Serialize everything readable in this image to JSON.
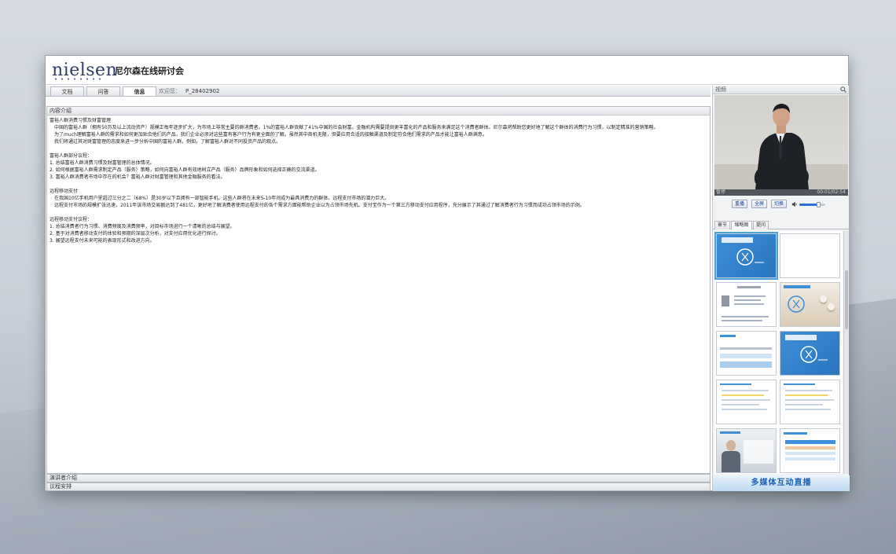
{
  "app": {
    "logo": "nielsen",
    "title": "尼尔森在线研讨会"
  },
  "tabs": [
    {
      "label": "文档"
    },
    {
      "label": "问答"
    },
    {
      "label": "信息"
    }
  ],
  "welcome": {
    "label": "欢迎您：",
    "user": "P_28402902"
  },
  "content": {
    "section_title": "内容介绍",
    "blocks": [
      {
        "text": "富裕人群消费习惯及财富管理",
        "indent": false
      },
      {
        "text": "中国的富裕人群（拥有50万及以上流动资产）规模正每年逐步扩大，为市场上非常主要的群消费者。1%的富裕人群贡献了41%中国的社会财富。金融机构需要提供更丰富化的产品和服务来满足这个消费者群体。尼尔森将帮助您更好地了解这个群体的消费行为习惯，以制定精准的营销策略。",
        "indent": true
      },
      {
        "text": "为了much理解富裕人群的需求和如何更加贴合他们的产品，我们企业必须对这些富有客户行为有更全面的了解。虽然其中商机无限，但要应用合适的接触渠道及制定符合他们需求的产品才能让富裕人群满意。",
        "indent": true
      },
      {
        "text": "我们将通过其对财富管理的态度来进一步分析中国的富裕人群。例如，了解富裕人群对不同投资产品的观点。",
        "indent": true
      },
      {
        "text": "",
        "indent": false
      },
      {
        "text": "富裕人群部分议程：",
        "indent": false
      },
      {
        "text": "1. 总结富裕人群消费习惯及财富管理的总体情况。",
        "indent": false
      },
      {
        "text": "2. 如何根据富裕人群需求制定产品（服务）策略，如何向富裕人群有效地树立产品（服务）品牌形象和如何选择正确的交流渠道。",
        "indent": false
      },
      {
        "text": "3. 富裕人群消费者市场中存在的机会？富裕人群对财富管理和其他金融服务的看法。",
        "indent": false
      },
      {
        "text": "",
        "indent": false
      },
      {
        "text": "远程移动支付",
        "indent": false
      },
      {
        "text": "在我国10亿手机用户里超过三分之二（68%）是30岁以下且拥有一部智能手机。这些人群将在未来5-10年间成为最具消费力的群体。远程支付市场的潜力巨大。",
        "indent": true
      },
      {
        "text": "远程支付市场的规模扩张迅速，2011年该市场交易额达到了481亿，更好地了解消费者使用远程支付的各个需求方面能帮助企业以为占领市场先机。支付宝作为一个第三方移动支付应用程序，充分展示了其通过了解消费者行为习惯而成功占领市场的示例。",
        "indent": true
      },
      {
        "text": "",
        "indent": false
      },
      {
        "text": "远程移动支付议程：",
        "indent": false
      },
      {
        "text": "1. 总结消费者行为习惯、消费频度及消费频率，对目标市场进行一个清晰的总结与展望。",
        "indent": false
      },
      {
        "text": "2. 基于对消费者移动支付的体验和预期的深层次分析，对支付应用优化进行探讨。",
        "indent": false
      },
      {
        "text": "3. 展望远程支付未来可能的表现形式和改进方向。",
        "indent": false
      }
    ],
    "presenter_section": "演讲者介绍",
    "agenda_section": "议程安排"
  },
  "video": {
    "label": "视频",
    "status_left": "暂停",
    "time": "00:01/02:54",
    "buttons": [
      "重播",
      "全屏",
      "切换"
    ],
    "volume": 0.75
  },
  "thumb_tabs": [
    {
      "label": "章节"
    },
    {
      "label": "缩略图"
    },
    {
      "label": "提问"
    }
  ],
  "thumbs": [
    {
      "style": "blue-cover",
      "selected": true
    },
    {
      "style": "blank"
    },
    {
      "style": "speaker"
    },
    {
      "style": "blue-chess"
    },
    {
      "style": "chart"
    },
    {
      "style": "blue-cover"
    },
    {
      "style": "text-slide"
    },
    {
      "style": "text-slide"
    },
    {
      "style": "photo-man"
    },
    {
      "style": "table"
    }
  ],
  "brand_label": "多媒体互动直播",
  "colors": {
    "accent": "#2e6fd2",
    "brand": "#1b62b8",
    "slide_blue": "#3d8fd8"
  }
}
